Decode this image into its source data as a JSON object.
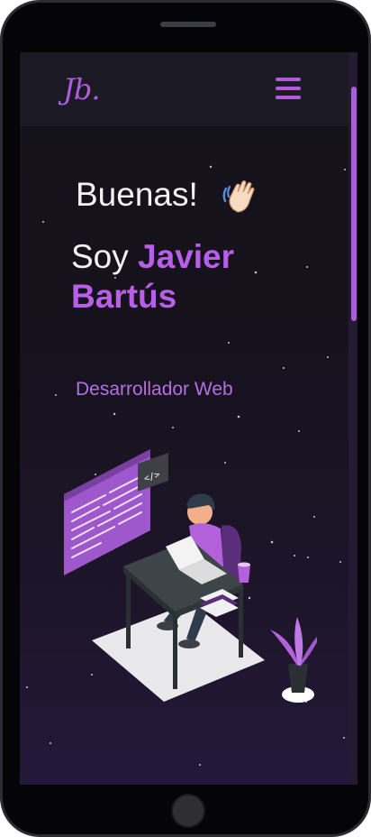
{
  "navbar": {
    "logo": "Jb.",
    "menu_icon": "hamburger-menu-icon"
  },
  "hero": {
    "greeting": "Buenas!",
    "greeting_icon": "waving-hand-icon",
    "intro_prefix": "Soy ",
    "name_line1": "Javier",
    "name_line2": "Bartús",
    "role": "Desarrollador Web",
    "illustration_icon": "web-developer-illustration",
    "code_tag": "</>"
  },
  "colors": {
    "accent": "#b95ee8",
    "navbar_bg": "#1b1a24",
    "screen_bg": "#16121d",
    "text": "#f2f2f2"
  }
}
